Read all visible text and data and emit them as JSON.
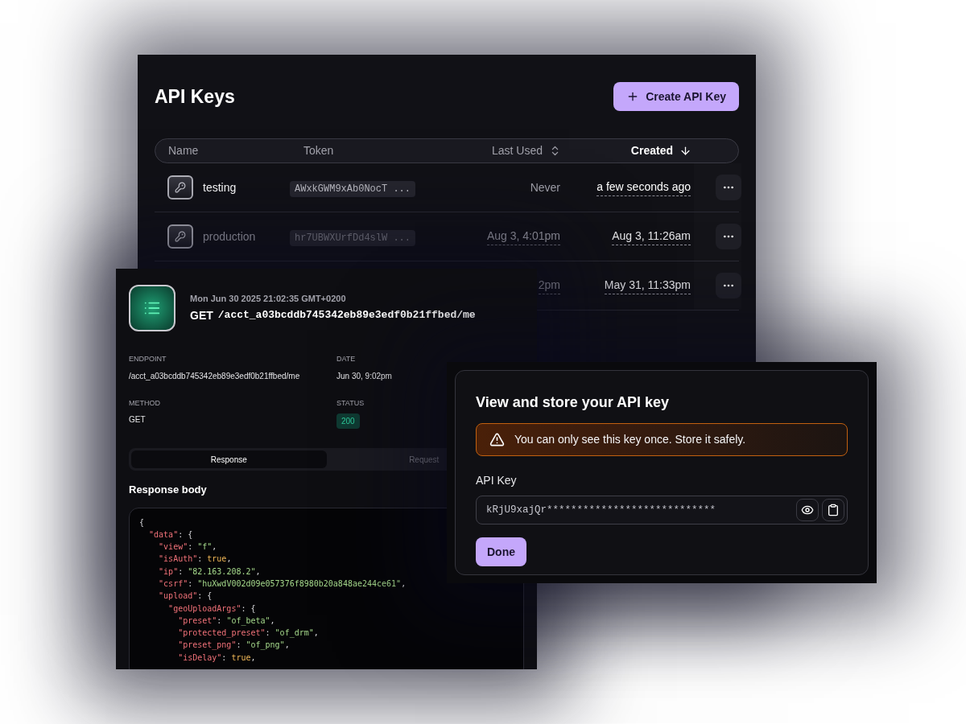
{
  "api_keys": {
    "title": "API Keys",
    "create_button": "Create API Key",
    "columns": [
      {
        "label": "Name",
        "kind": "plain"
      },
      {
        "label": "Token",
        "kind": "plain"
      },
      {
        "label": "Last Used",
        "kind": "sortable"
      },
      {
        "label": "Created",
        "kind": "sorted"
      }
    ],
    "rows": [
      {
        "name": "testing",
        "token": "AWxkGWM9xAb0NocT ...",
        "last_used": "Never",
        "last_used_underlined": false,
        "created": "a few seconds ago",
        "dimmed": false
      },
      {
        "name": "production",
        "token": "hr7UBWXUrfDd4slW ...",
        "last_used": "Aug 3, 4:01pm",
        "last_used_underlined": true,
        "created": "Aug 3, 11:26am",
        "dimmed": true
      },
      {
        "last_used": "2pm",
        "last_used_underlined": true,
        "created": "May 31, 11:33pm",
        "dimmed": true
      }
    ]
  },
  "request": {
    "timestamp": "Mon Jun 30 2025 21:02:35 GMT+0200",
    "method": "GET",
    "path": "/acct_a03bcddb745342eb89e3edf0b21ffbed/me",
    "fields": [
      {
        "label": "ENDPOINT",
        "value": "/acct_a03bcddb745342eb89e3edf0b21ffbed/me",
        "kind": "text"
      },
      {
        "label": "DATE",
        "value": "Jun 30, 9:02pm",
        "kind": "text"
      },
      {
        "label": "METHOD",
        "value": "GET",
        "kind": "text"
      },
      {
        "label": "STATUS",
        "value": "200",
        "kind": "badge"
      }
    ],
    "tabs": [
      {
        "label": "Response",
        "selected": true
      },
      {
        "label": "Request",
        "selected": false
      }
    ],
    "body_title": "Response body",
    "code": [
      [
        {
          "kind": "punct",
          "text": "{"
        }
      ],
      [
        {
          "kind": "key",
          "text": "  \"data\""
        },
        {
          "kind": "punct",
          "text": ": {"
        }
      ],
      [
        {
          "kind": "key",
          "text": "    \"view\""
        },
        {
          "kind": "punct",
          "text": ": "
        },
        {
          "kind": "string",
          "text": "\"f\""
        },
        {
          "kind": "punct",
          "text": ","
        }
      ],
      [
        {
          "kind": "key",
          "text": "    \"isAuth\""
        },
        {
          "kind": "punct",
          "text": ": "
        },
        {
          "kind": "bool",
          "text": "true"
        },
        {
          "kind": "punct",
          "text": ","
        }
      ],
      [
        {
          "kind": "key",
          "text": "    \"ip\""
        },
        {
          "kind": "punct",
          "text": ": "
        },
        {
          "kind": "string",
          "text": "\"82.163.208.2\""
        },
        {
          "kind": "punct",
          "text": ","
        }
      ],
      [
        {
          "kind": "key",
          "text": "    \"csrf\""
        },
        {
          "kind": "punct",
          "text": ": "
        },
        {
          "kind": "string",
          "text": "\"huXwdV002d09e057376f8980b20a848ae244ce61\""
        },
        {
          "kind": "punct",
          "text": ","
        }
      ],
      [
        {
          "kind": "key",
          "text": "    \"upload\""
        },
        {
          "kind": "punct",
          "text": ": {"
        }
      ],
      [
        {
          "kind": "key",
          "text": "      \"geoUploadArgs\""
        },
        {
          "kind": "punct",
          "text": ": {"
        }
      ],
      [
        {
          "kind": "key",
          "text": "        \"preset\""
        },
        {
          "kind": "punct",
          "text": ": "
        },
        {
          "kind": "string",
          "text": "\"of_beta\""
        },
        {
          "kind": "punct",
          "text": ","
        }
      ],
      [
        {
          "kind": "key",
          "text": "        \"protected_preset\""
        },
        {
          "kind": "punct",
          "text": ": "
        },
        {
          "kind": "string",
          "text": "\"of_drm\""
        },
        {
          "kind": "punct",
          "text": ","
        }
      ],
      [
        {
          "kind": "key",
          "text": "        \"preset_png\""
        },
        {
          "kind": "punct",
          "text": ": "
        },
        {
          "kind": "string",
          "text": "\"of_png\""
        },
        {
          "kind": "punct",
          "text": ","
        }
      ],
      [
        {
          "kind": "key",
          "text": "        \"isDelay\""
        },
        {
          "kind": "punct",
          "text": ": "
        },
        {
          "kind": "bool",
          "text": "true"
        },
        {
          "kind": "punct",
          "text": ","
        }
      ]
    ]
  },
  "dialog": {
    "title": "View and store your API key",
    "warning": "You can only see this key once. Store it safely.",
    "field_label": "API Key",
    "key_value": "kRjU9xajQr****************************",
    "done_button": "Done"
  }
}
